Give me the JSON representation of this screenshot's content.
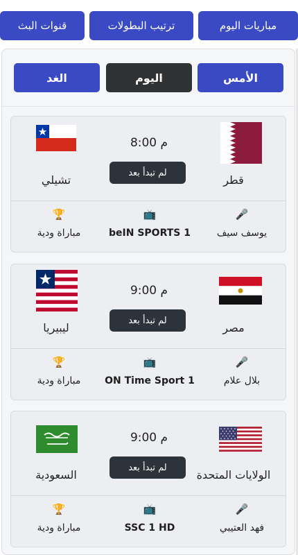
{
  "nav": {
    "items": [
      {
        "label": "مباريات اليوم"
      },
      {
        "label": "ترتيب البطولات"
      },
      {
        "label": "قنوات البث"
      }
    ]
  },
  "days": {
    "items": [
      {
        "label": "الأمس",
        "active": false
      },
      {
        "label": "اليوم",
        "active": true
      },
      {
        "label": "الغد",
        "active": false
      }
    ]
  },
  "matches": [
    {
      "home": {
        "name": "قطر",
        "flag": "flag-qatar-icon"
      },
      "away": {
        "name": "تشيلي",
        "flag": "flag-chile-icon"
      },
      "time": "8:00 م",
      "status": "لم تبدأ بعد",
      "commentator": "يوسف سيف",
      "channel": "beIN SPORTS 1",
      "competition": "مباراة ودية"
    },
    {
      "home": {
        "name": "مصر",
        "flag": "flag-egypt-icon"
      },
      "away": {
        "name": "ليبيريا",
        "flag": "flag-liberia-icon"
      },
      "time": "9:00 م",
      "status": "لم تبدأ بعد",
      "commentator": "بلال علام",
      "channel": "ON Time Sport 1",
      "competition": "مباراة ودية"
    },
    {
      "home": {
        "name": "الولايات المتحدة",
        "flag": "flag-usa-icon"
      },
      "away": {
        "name": "السعودية",
        "flag": "flag-saudi-icon"
      },
      "time": "9:00 م",
      "status": "لم تبدأ بعد",
      "commentator": "فهد العتيبي",
      "channel": "SSC 1 HD",
      "competition": "مباراة ودية"
    }
  ],
  "icons": {
    "commentator": "microphone-icon",
    "channel": "tv-icon",
    "competition": "trophy-icon"
  },
  "colors": {
    "primary": "#3a49c4",
    "active_day": "#303133",
    "status_badge": "#2d333b"
  }
}
